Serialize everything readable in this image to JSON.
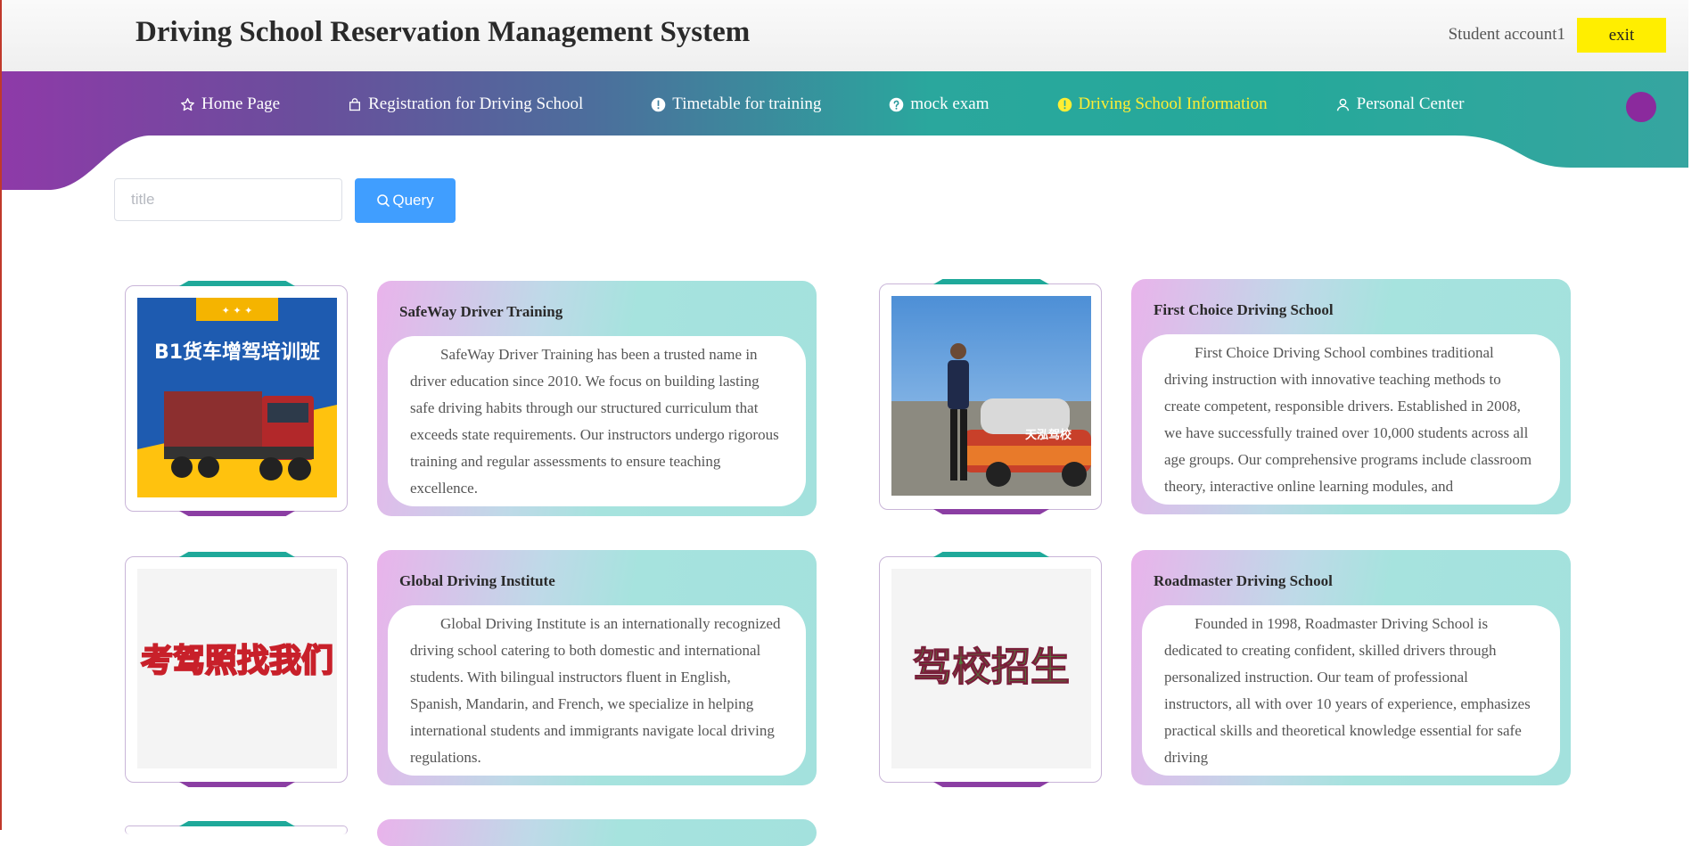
{
  "header": {
    "title": "Driving School Reservation Management System",
    "account": "Student account1",
    "exit_label": "exit"
  },
  "nav": {
    "items": [
      {
        "label": "Home Page",
        "icon": "star-icon"
      },
      {
        "label": "Registration for Driving School",
        "icon": "bag-icon"
      },
      {
        "label": "Timetable for training",
        "icon": "info-icon"
      },
      {
        "label": "mock exam",
        "icon": "question-icon"
      },
      {
        "label": "Driving School Information",
        "icon": "info-icon",
        "active": true
      },
      {
        "label": "Personal Center",
        "icon": "user-icon"
      }
    ],
    "active_color": "#ffee33"
  },
  "search": {
    "placeholder": "title",
    "button_label": "Query"
  },
  "schools": [
    {
      "name": "SafeWay Driver Training",
      "description": "SafeWay Driver Training has been a trusted name in driver education since 2010. We focus on building lasting safe driving habits through our structured curriculum that exceeds state requirements. Our instructors undergo rigorous training and regular assessments to ensure teaching excellence.",
      "image_text": "B1货车增驾培训班"
    },
    {
      "name": "First Choice Driving School",
      "description": "First Choice Driving School combines traditional driving instruction with innovative teaching methods to create competent, responsible drivers. Established in 2008, we have successfully trained over 10,000 students across all age groups. Our comprehensive programs include classroom theory, interactive online learning modules, and",
      "image_text": "天泓驾校"
    },
    {
      "name": "Global Driving Institute",
      "description": "Global Driving Institute is an internationally recognized driving school catering to both domestic and international students. With bilingual instructors fluent in English, Spanish, Mandarin, and French, we specialize in helping international students and immigrants navigate local driving regulations.",
      "image_text": "考驾照找我们"
    },
    {
      "name": "Roadmaster Driving School",
      "description": "Founded in 1998, Roadmaster Driving School is dedicated to creating confident, skilled drivers through personalized instruction. Our team of professional instructors, all with over 10 years of experience, emphasizes practical skills and theoretical knowledge essential for safe driving",
      "image_text": "驾校招生"
    }
  ],
  "colors": {
    "exit_button": "#ffee00",
    "query_button": "#409eff",
    "avatar": "#8b2a9d"
  }
}
